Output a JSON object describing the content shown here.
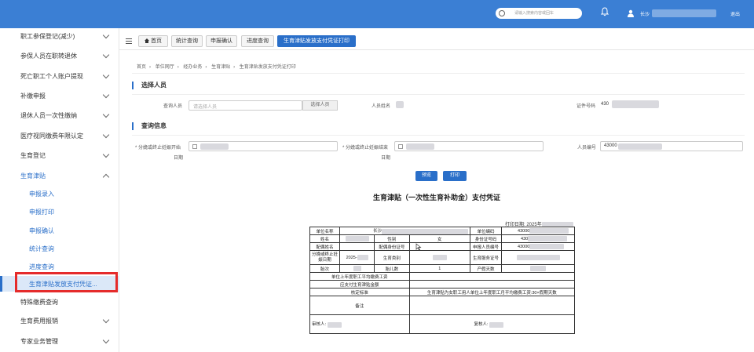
{
  "header": {
    "search_placeholder": "请输入搜索内容或回车",
    "user_name": "长沙",
    "logout_label": "退出",
    "icons": [
      "search-icon",
      "bell-icon",
      "user-icon"
    ]
  },
  "sidebar": {
    "items": [
      {
        "label": "职工参保登记(减少)",
        "chevron": "down"
      },
      {
        "label": "参保人员在职转退休",
        "chevron": "down"
      },
      {
        "label": "死亡职工个人账户提现",
        "chevron": "down"
      },
      {
        "label": "补缴申报",
        "chevron": "down"
      },
      {
        "label": "退休人员一次性缴纳",
        "chevron": "down"
      },
      {
        "label": "医疗视同缴费年限认定",
        "chevron": "down"
      },
      {
        "label": "生育登记",
        "chevron": "down"
      },
      {
        "label": "生育津贴",
        "chevron": "up"
      }
    ],
    "sub_items": [
      {
        "label": "申报录入"
      },
      {
        "label": "申报打印"
      },
      {
        "label": "申报确认"
      },
      {
        "label": "统计查询"
      },
      {
        "label": "进度查询"
      },
      {
        "label": "生育津贴发放支付凭证..."
      }
    ],
    "bottom_items": [
      {
        "label": "特殊缴费查询",
        "chevron": ""
      },
      {
        "label": "生育费用报销",
        "chevron": "down"
      },
      {
        "label": "专家业务管理",
        "chevron": "down"
      }
    ]
  },
  "tabs": {
    "home": "首页",
    "items": [
      "统计查询",
      "申报确认",
      "进度查询"
    ],
    "active": "生育津贴发放支付凭证打印"
  },
  "breadcrumb": [
    "首页",
    "单位网厅",
    "经办业务",
    "生育津贴",
    "生育津贴发放支付凭证打印"
  ],
  "select_person": {
    "section_title": "选择人员",
    "query_label": "查询人员",
    "query_placeholder": "请选择人员",
    "select_button": "选择人员",
    "name_label": "人员姓名",
    "id_label": "证件号码",
    "id_value": "430"
  },
  "query_info": {
    "section_title": "查询信息",
    "start_label_1": "* 分娩或终止妊娠开始",
    "start_label_2": "日期",
    "end_label_1": "* 分娩或终止妊娠结束",
    "end_label_2": "日期",
    "person_no_label": "人员编号",
    "person_no_value": "43000",
    "preview_button": "预览",
    "print_button": "打印"
  },
  "voucher": {
    "title": "生育津贴（一次性生育补助金）支付凭证",
    "print_date_label": "打印日期: ",
    "print_date_value": "2025年",
    "unit_name_label": "单位名称",
    "unit_name_value": "长沙",
    "unit_code_label": "单位编码",
    "unit_code_value": "43000",
    "name_label": "姓名",
    "gender_label": "性别",
    "gender_value": "女",
    "id_label": "身份证号码",
    "id_value": "430",
    "spouse_name_label": "配偶姓名",
    "spouse_id_label": "配偶身份证号",
    "applicant_no_label": "申报人员编号",
    "applicant_no_value": "43000",
    "birth_date_label": "分娩或终止妊娠日期",
    "birth_date_value": "2025-",
    "type_label": "生育类别",
    "service_no_label": "生育服务证号",
    "parity_label": "胎次",
    "babies_label": "胎儿数",
    "babies_value": "1",
    "leave_days_label": "产假天数",
    "avg_wage_label": "单位上年度职工平均缴费工资",
    "amount_label": "应支付生育津贴金额",
    "standard_label": "核定标准",
    "standard_value": "生育津贴为女职工用人单位上年度职工月平均缴费工资:30×假期天数",
    "remark_label": "备注",
    "reviewer_label": "审核人: ",
    "checker_label": "复核人: "
  },
  "colors": {
    "topbar": "#3b7fd4",
    "accent": "#2a6fc9",
    "highlight": "#e52b2b"
  }
}
